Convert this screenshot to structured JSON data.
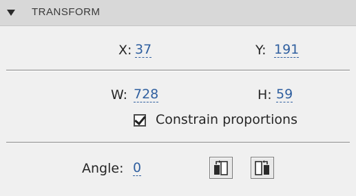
{
  "header": {
    "title": "TRANSFORM",
    "collapse_icon": "triangle-down-icon"
  },
  "position": {
    "x_label": "X:",
    "x_value": "37",
    "y_label": "Y:",
    "y_value": "191"
  },
  "size": {
    "w_label": "W:",
    "w_value": "728",
    "h_label": "H:",
    "h_value": "59",
    "constrain_label": "Constrain proportions",
    "constrain_checked": true
  },
  "rotation": {
    "angle_label": "Angle:",
    "angle_value": "0",
    "buttons": [
      "rotate-left-icon",
      "rotate-right-icon"
    ]
  },
  "colors": {
    "value_link": "#2f5f9f",
    "header_bg": "#d8d8d8",
    "panel_bg": "#f0f0f0"
  }
}
